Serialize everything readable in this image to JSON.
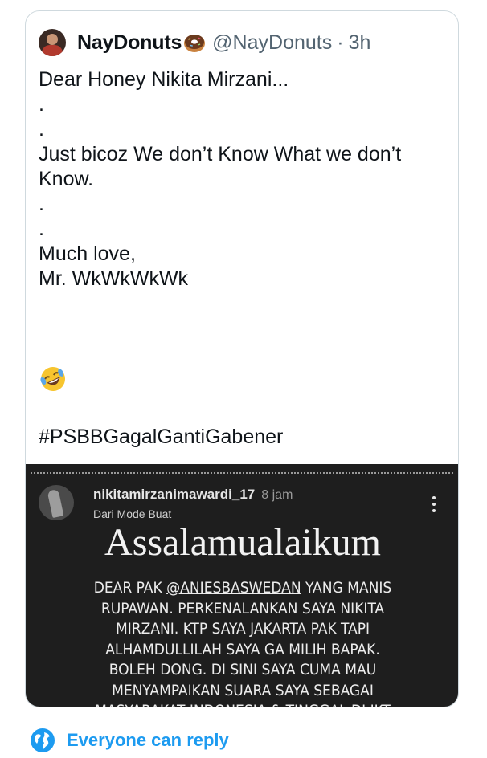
{
  "tweet": {
    "display_name": "NayDonuts",
    "name_emoji": "doughnut-emoji",
    "handle": "@NayDonuts",
    "separator": "·",
    "time": "3h",
    "text_lines": [
      "Dear Honey Nikita Mirzani...",
      ".",
      ".",
      "Just bicoz We don’t Know What we don’t",
      "Know.",
      ".",
      ".",
      "Much love,",
      "Mr. WkWkWkWk"
    ],
    "emoji": "rolling-on-the-floor-laughing-emoji",
    "hashtag": "#PSBBGagalGantiGabener"
  },
  "story": {
    "username": "nikitamirzanimawardi_17",
    "time": "8 jam",
    "mode": "Dari Mode Buat",
    "title": "Assalamualaikum",
    "line1_pre": "DEAR PAK ",
    "line1_mention": "@ANIESBASWEDAN",
    "line1_post": " YANG MANIS",
    "lines": [
      "RUPAWAN. PERKENALANKAN SAYA NIKITA",
      "MIRZANI. KTP SAYA JAKARTA PAK TAPI",
      "ALHAMDULLILAH SAYA GA MILIH BAPAK.",
      "BOLEH DONG. DI SINI SAYA CUMA MAU",
      "MENYAMPAIKAN SUARA SAYA SEBAGAI",
      "MASYARAKAT INDONESIA & TINGGAL DI JKT"
    ]
  },
  "reply": {
    "label": "Everyone can reply",
    "icon": "globe-icon"
  },
  "colors": {
    "accent": "#1d9bf0",
    "text": "#0f1419",
    "secondary": "#536471",
    "border": "#cfd9de",
    "story_bg": "#1e1e1e"
  }
}
